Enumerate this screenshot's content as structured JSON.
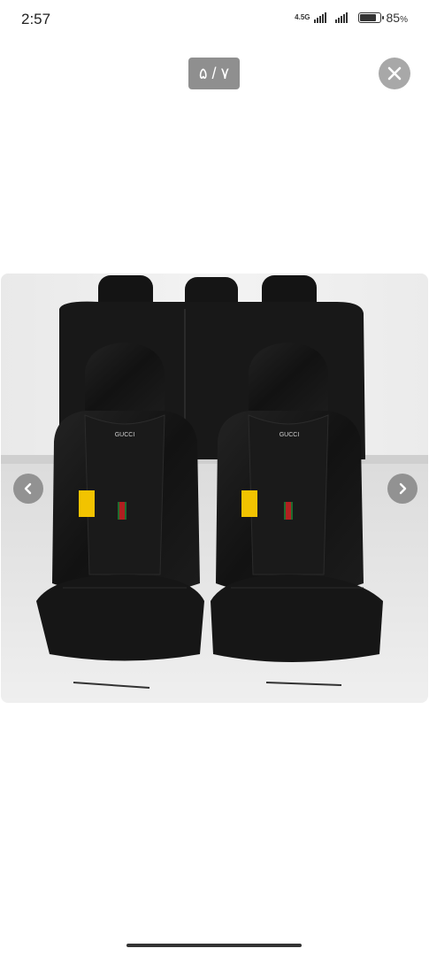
{
  "status_bar": {
    "time": "2:57",
    "network": "4.5G",
    "battery_level": 0.85,
    "battery_percent": "85",
    "battery_unit": "%"
  },
  "viewer": {
    "page_counter": "۵ / ۷",
    "close_icon": "close-icon",
    "prev_icon": "chevron-left-icon",
    "next_icon": "chevron-right-icon"
  },
  "photo": {
    "subject": "black leather car seat covers",
    "badge_text": "GUCCI"
  },
  "colors": {
    "background": "#ffffff",
    "counter_bg": "#8f8f8f",
    "close_bg": "#a8a8a8",
    "seat_black": "#141414"
  }
}
